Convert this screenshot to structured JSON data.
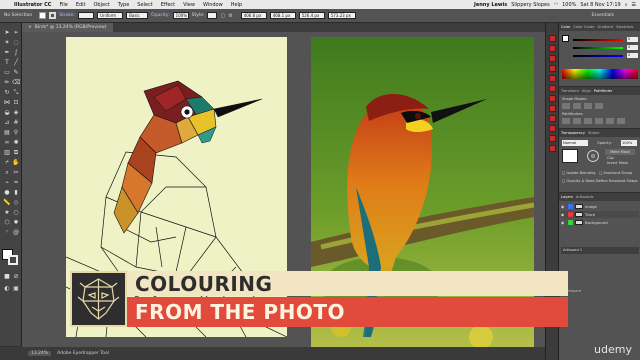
{
  "menubar": {
    "apple_icon": "apple-icon",
    "app_name": "Illustrator CC",
    "items": [
      "File",
      "Edit",
      "Object",
      "Type",
      "Select",
      "Effect",
      "View",
      "Window",
      "Help"
    ],
    "user_name": "Jenny Lewis",
    "document_name": "Slippery Slopes",
    "battery": "100%",
    "datetime": "Sat 8 Nov  17:19"
  },
  "controlbar": {
    "selection": "No Selection",
    "stroke_label": "Stroke:",
    "stroke_profile": "Uniform",
    "brush": "Basic",
    "opacity_label": "Opacity:",
    "opacity": "100%",
    "style_label": "Style:",
    "x_value": "406.6 px",
    "y_value": "468.1 px",
    "w_value": "526.4 px",
    "h_value": "573.23 px",
    "workspace": "Essentials"
  },
  "document": {
    "tab_title": "Birds* @ 13.24% (RGB/Preview)",
    "zoom": "13.24%",
    "status_tool": "Adobe Eyedropper Tool"
  },
  "panels": {
    "color_tabs": [
      "Color",
      "Color Guide",
      "Gradient",
      "Swatches"
    ],
    "color_values": [
      "0",
      "0",
      "0"
    ],
    "transform_tabs": [
      "Transform",
      "Align",
      "Pathfinder"
    ],
    "shape_modes_label": "Shape Modes:",
    "pathfinders_label": "Pathfinders:",
    "transparency_tabs": [
      "Transparency",
      "Stroke"
    ],
    "blend_mode": "Normal",
    "opacity_label": "Opacity:",
    "opacity_value": "100%",
    "make_mask": "Make Mask",
    "clip_label": "Clip",
    "invert_label": "Invert Mask",
    "isolate": "Isolate Blending",
    "knockout": "Knockout Group",
    "opacity_mask": "Opacity & Mask Define Knockout Shape",
    "layers_tabs": [
      "Layers",
      "Artboards"
    ],
    "layers": [
      {
        "name": "Image",
        "color": "#3b6ef5"
      },
      {
        "name": "Trace",
        "color": "#e23b3b"
      },
      {
        "name": "Background",
        "color": "#3bd13b"
      }
    ],
    "artboard_label": "Artboard 1",
    "layers_count": "1 Artboard"
  },
  "banner": {
    "line1": "COLOURING",
    "line2": "FROM THE PHOTO",
    "logo_icon": "tribal-mask-icon",
    "logo_color": "#e6d9a7",
    "line1_bg": "#f1e6c1",
    "line2_bg": "#e24a3b"
  },
  "watermark": "udemy"
}
